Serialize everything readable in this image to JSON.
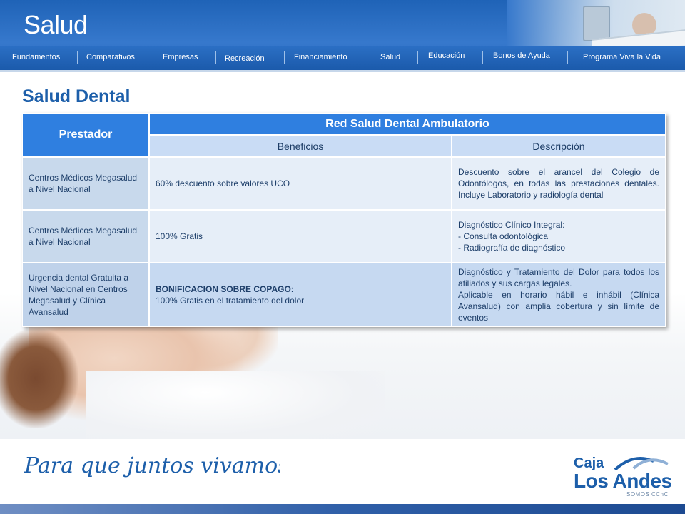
{
  "header": {
    "title": "Salud"
  },
  "nav": {
    "items": [
      "Fundamentos",
      "Comparativos",
      "Empresas",
      "Recreación",
      "Financiamiento",
      "Salud",
      "Educación",
      "Bonos de Ayuda",
      "Programa Viva la Vida"
    ]
  },
  "section": {
    "title": "Salud Dental"
  },
  "table": {
    "provider_header": "Prestador",
    "network_header": "Red Salud Dental Ambulatorio",
    "benefits_header": "Beneficios",
    "description_header": "Descripción",
    "rows": [
      {
        "provider": "Centros Médicos Megasalud a Nivel Nacional",
        "benefit": "60% descuento sobre valores UCO",
        "description": "Descuento sobre el arancel del Colegio de Odontólogos, en todas las prestaciones dentales. Incluye Laboratorio y radiología dental"
      },
      {
        "provider": "Centros Médicos Megasalud a Nivel Nacional",
        "benefit": "100% Gratis",
        "description_lines": [
          "Diagnóstico Clínico Integral:",
          "- Consulta odontológica",
          "- Radiografía de diagnóstico"
        ]
      },
      {
        "provider": "Urgencia dental Gratuita a Nivel Nacional en Centros Megasalud y Clínica Avansalud",
        "benefit_title": "BONIFICACION SOBRE COPAGO:",
        "benefit": "100% Gratis en el tratamiento del dolor",
        "description_lines": [
          "Diagnóstico y Tratamiento del Dolor para todos los afiliados y sus cargas legales.",
          "Aplicable en horario hábil e inhábil (Clínica Avansalud) con amplia cobertura y sin límite de eventos"
        ]
      }
    ]
  },
  "footer": {
    "slogan": "Para que juntos vivamos mejor.",
    "logo_line1": "Caja",
    "logo_line2": "Los Andes",
    "logo_tagline": "SOMOS CChC"
  },
  "colors": {
    "brand_blue": "#1d5faa",
    "header_blue": "#2f7fe0",
    "subheader_blue": "#c9dcf5"
  },
  "icons": {
    "logo_mark": "mountain-arcs-icon"
  }
}
